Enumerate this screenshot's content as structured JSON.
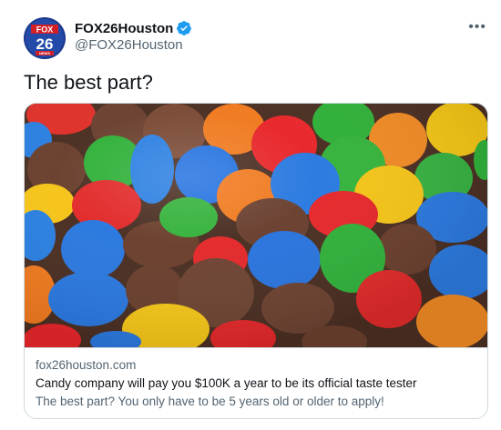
{
  "author": {
    "display_name": "FOX26Houston",
    "handle": "@FOX26Houston",
    "verified": true,
    "avatar_logo_text": [
      "FOX",
      "26",
      "NEWS"
    ]
  },
  "tweet": {
    "text": "The best part?",
    "more_icon": "more-horizontal-icon"
  },
  "card": {
    "image_description_icon": "candy-photo",
    "domain": "fox26houston.com",
    "title": "Candy company will pay you $100K a year to be its official taste tester",
    "description": "The best part? You only have to be 5 years old or older to apply!"
  },
  "colors": {
    "verified_badge": "#1d9bf0",
    "secondary_text": "#536471",
    "border": "#cfd9de"
  }
}
